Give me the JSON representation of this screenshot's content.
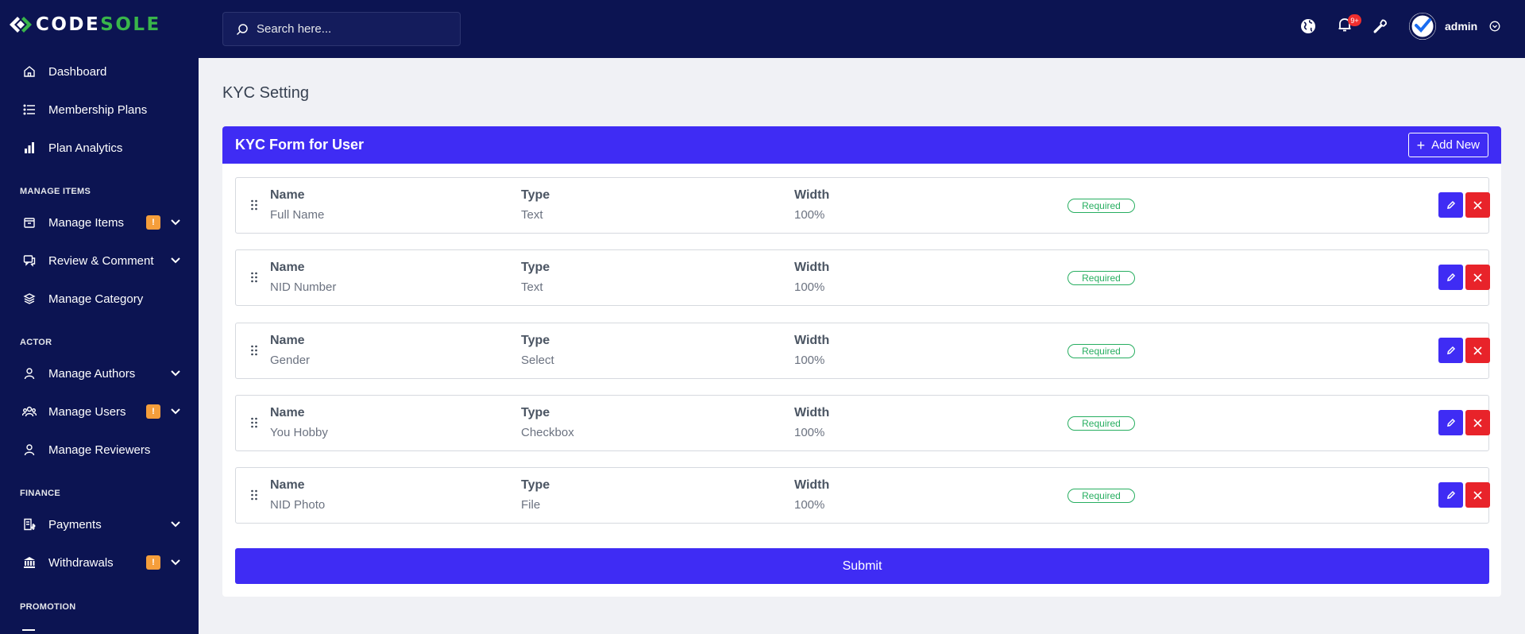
{
  "brand": {
    "logo_part1": "CODE",
    "logo_part2": "SOLE",
    "accent": "#39b54a"
  },
  "sidebar": {
    "items": [
      {
        "label": "Dashboard",
        "icon": "home-icon"
      },
      {
        "label": "Membership Plans",
        "icon": "list-icon"
      },
      {
        "label": "Plan Analytics",
        "icon": "bar-chart-icon"
      },
      {
        "label": "Manage Items",
        "icon": "box-icon",
        "badge": "!"
      },
      {
        "label": "Review & Comment",
        "icon": "chat-icon"
      },
      {
        "label": "Manage Category",
        "icon": "layers-icon"
      },
      {
        "label": "Manage Authors",
        "icon": "user-icon"
      },
      {
        "label": "Manage Users",
        "icon": "users-icon",
        "badge": "!"
      },
      {
        "label": "Manage Reviewers",
        "icon": "user-icon"
      },
      {
        "label": "Payments",
        "icon": "invoice-icon"
      },
      {
        "label": "Withdrawals",
        "icon": "bank-icon",
        "badge": "!"
      }
    ],
    "sections": {
      "manage_items": "MANAGE ITEMS",
      "actor": "ACTOR",
      "finance": "FINANCE",
      "promotion": "PROMOTION"
    }
  },
  "topbar": {
    "search_placeholder": "Search here...",
    "notification_count": "9+",
    "user_name": "admin"
  },
  "page": {
    "title": "KYC Setting",
    "card_title": "KYC Form for User",
    "add_new_label": "Add New",
    "submit_label": "Submit",
    "column_headers": {
      "name": "Name",
      "type": "Type",
      "width": "Width"
    },
    "required_label": "Required",
    "fields": [
      {
        "name": "Full Name",
        "type": "Text",
        "width": "100%"
      },
      {
        "name": "NID Number",
        "type": "Text",
        "width": "100%"
      },
      {
        "name": "Gender",
        "type": "Select",
        "width": "100%"
      },
      {
        "name": "You Hobby",
        "type": "Checkbox",
        "width": "100%"
      },
      {
        "name": "NID Photo",
        "type": "File",
        "width": "100%"
      }
    ]
  },
  "colors": {
    "sidebar_bg": "#0c1452",
    "primary": "#3f2cf4",
    "danger": "#e8232a",
    "success": "#27ae60",
    "warning": "#f59e3b"
  }
}
